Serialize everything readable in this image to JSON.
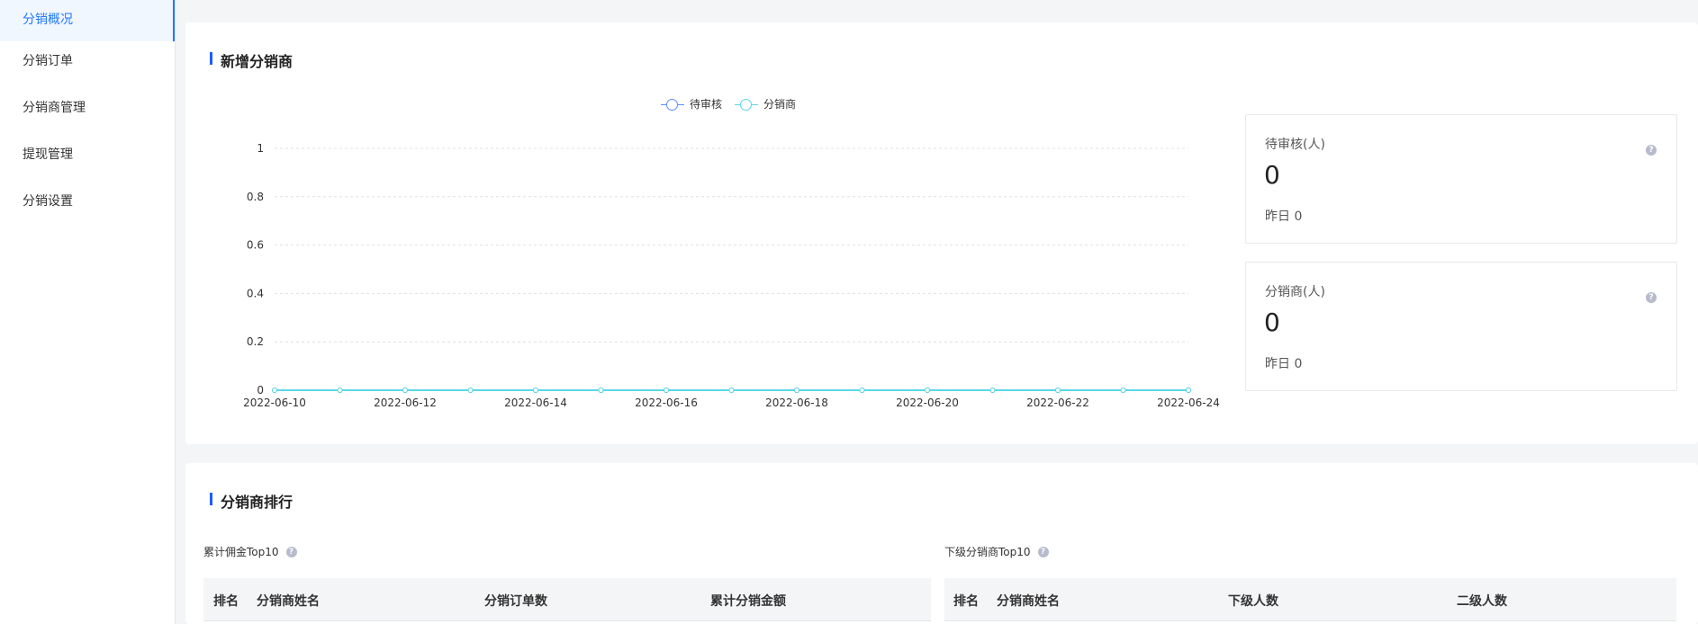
{
  "sidebar": {
    "items": [
      {
        "label": "分销概况",
        "active": true
      },
      {
        "label": "分销订单"
      },
      {
        "label": "分销商管理"
      },
      {
        "label": "提现管理"
      },
      {
        "label": "分销设置"
      }
    ]
  },
  "overview": {
    "title": "新增分销商",
    "stats": [
      {
        "label": "待审核(人)",
        "value": "0",
        "yesterday": "昨日 0"
      },
      {
        "label": "分销商(人)",
        "value": "0",
        "yesterday": "昨日 0"
      }
    ]
  },
  "ranking": {
    "title": "分销商排行",
    "left": {
      "subtitle": "累计佣金Top10",
      "columns": [
        "排名",
        "分销商姓名",
        "分销订单数",
        "累计分销金额"
      ]
    },
    "right": {
      "subtitle": "下级分销商Top10",
      "columns": [
        "排名",
        "分销商姓名",
        "下级人数",
        "二级人数"
      ]
    }
  },
  "chart_data": {
    "type": "line",
    "x": [
      "2022-06-10",
      "2022-06-11",
      "2022-06-12",
      "2022-06-13",
      "2022-06-14",
      "2022-06-15",
      "2022-06-16",
      "2022-06-17",
      "2022-06-18",
      "2022-06-19",
      "2022-06-20",
      "2022-06-21",
      "2022-06-22",
      "2022-06-23",
      "2022-06-24"
    ],
    "x_tick_labels": [
      "2022-06-10",
      "2022-06-12",
      "2022-06-14",
      "2022-06-16",
      "2022-06-18",
      "2022-06-20",
      "2022-06-22",
      "2022-06-24"
    ],
    "series": [
      {
        "name": "待审核",
        "color": "#5b8ff9",
        "values": [
          0,
          0,
          0,
          0,
          0,
          0,
          0,
          0,
          0,
          0,
          0,
          0,
          0,
          0,
          0
        ]
      },
      {
        "name": "分销商",
        "color": "#5ad8e6",
        "values": [
          0,
          0,
          0,
          0,
          0,
          0,
          0,
          0,
          0,
          0,
          0,
          0,
          0,
          0,
          0
        ]
      }
    ],
    "y_ticks": [
      "0",
      "0.2",
      "0.4",
      "0.6",
      "0.8",
      "1"
    ],
    "ylim": [
      0,
      1
    ],
    "grid": true,
    "legend": "top-center"
  },
  "colors": {
    "accent": "#1f78ff",
    "title_bar": "#1f5cff"
  }
}
